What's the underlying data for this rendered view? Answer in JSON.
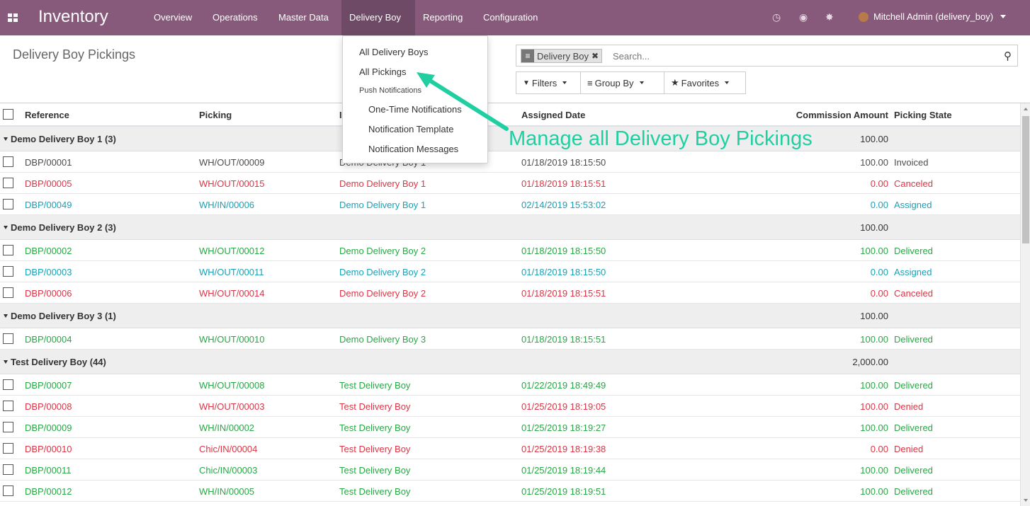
{
  "topbar": {
    "app_title": "Inventory",
    "menu": [
      "Overview",
      "Operations",
      "Master Data",
      "Delivery Boy",
      "Reporting",
      "Configuration"
    ],
    "active_menu": "Delivery Boy",
    "user": "Mitchell Admin (delivery_boy)",
    "icons": [
      "apps-icon",
      "clock-icon",
      "chat-icon",
      "bug-icon",
      "avatar"
    ],
    "colors": {
      "bar": "#875a7b",
      "active": "#6f4a66"
    }
  },
  "control_panel": {
    "breadcrumb": "Delivery Boy Pickings",
    "search": {
      "facet": "Delivery Boy",
      "placeholder": "Search..."
    },
    "buttons": {
      "filters": "Filters",
      "group_by": "Group By",
      "favorites": "Favorites"
    }
  },
  "dropdown": {
    "items": [
      "All Delivery Boys",
      "All Pickings"
    ],
    "header": "Push Notifications",
    "sub_items": [
      "One-Time Notifications",
      "Notification Template",
      "Notification Messages"
    ]
  },
  "annotation": {
    "text": "Manage all Delivery Boy Pickings",
    "color": "#1fcfa1"
  },
  "table": {
    "headers": [
      "Reference",
      "Picking",
      "Delivery Boy",
      "Assigned Date",
      "Commission Amount",
      "Picking State"
    ],
    "header_visible": [
      "Reference",
      "Picking",
      "I",
      "Assigned Date",
      "Commission Amount",
      "Picking State"
    ],
    "groups": [
      {
        "label": "Demo Delivery Boy 1 (3)",
        "total": "100.00",
        "rows": [
          {
            "ref": "DBP/00001",
            "picking": "WH/OUT/00009",
            "boy": "Demo Delivery Boy 1",
            "date": "01/18/2019 18:15:50",
            "amount": "100.00",
            "state": "Invoiced",
            "color": "default"
          },
          {
            "ref": "DBP/00005",
            "picking": "WH/OUT/00015",
            "boy": "Demo Delivery Boy 1",
            "date": "01/18/2019 18:15:51",
            "amount": "0.00",
            "state": "Canceled",
            "color": "red"
          },
          {
            "ref": "DBP/00049",
            "picking": "WH/IN/00006",
            "boy": "Demo Delivery Boy 1",
            "date": "02/14/2019 15:53:02",
            "amount": "0.00",
            "state": "Assigned",
            "color": "blue"
          }
        ]
      },
      {
        "label": "Demo Delivery Boy 2 (3)",
        "total": "100.00",
        "rows": [
          {
            "ref": "DBP/00002",
            "picking": "WH/OUT/00012",
            "boy": "Demo Delivery Boy 2",
            "date": "01/18/2019 18:15:50",
            "amount": "100.00",
            "state": "Delivered",
            "color": "green"
          },
          {
            "ref": "DBP/00003",
            "picking": "WH/OUT/00011",
            "boy": "Demo Delivery Boy 2",
            "date": "01/18/2019 18:15:50",
            "amount": "0.00",
            "state": "Assigned",
            "color": "blue"
          },
          {
            "ref": "DBP/00006",
            "picking": "WH/OUT/00014",
            "boy": "Demo Delivery Boy 2",
            "date": "01/18/2019 18:15:51",
            "amount": "0.00",
            "state": "Canceled",
            "color": "red"
          }
        ]
      },
      {
        "label": "Demo Delivery Boy 3 (1)",
        "total": "100.00",
        "rows": [
          {
            "ref": "DBP/00004",
            "picking": "WH/OUT/00010",
            "boy": "Demo Delivery Boy 3",
            "date": "01/18/2019 18:15:51",
            "amount": "100.00",
            "state": "Delivered",
            "color": "green"
          }
        ]
      },
      {
        "label": "Test Delivery Boy (44)",
        "total": "2,000.00",
        "rows": [
          {
            "ref": "DBP/00007",
            "picking": "WH/OUT/00008",
            "boy": "Test Delivery Boy",
            "date": "01/22/2019 18:49:49",
            "amount": "100.00",
            "state": "Delivered",
            "color": "green"
          },
          {
            "ref": "DBP/00008",
            "picking": "WH/OUT/00003",
            "boy": "Test Delivery Boy",
            "date": "01/25/2019 18:19:05",
            "amount": "100.00",
            "state": "Denied",
            "color": "red"
          },
          {
            "ref": "DBP/00009",
            "picking": "WH/IN/00002",
            "boy": "Test Delivery Boy",
            "date": "01/25/2019 18:19:27",
            "amount": "100.00",
            "state": "Delivered",
            "color": "green"
          },
          {
            "ref": "DBP/00010",
            "picking": "Chic/IN/00004",
            "boy": "Test Delivery Boy",
            "date": "01/25/2019 18:19:38",
            "amount": "0.00",
            "state": "Denied",
            "color": "red"
          },
          {
            "ref": "DBP/00011",
            "picking": "Chic/IN/00003",
            "boy": "Test Delivery Boy",
            "date": "01/25/2019 18:19:44",
            "amount": "100.00",
            "state": "Delivered",
            "color": "green"
          },
          {
            "ref": "DBP/00012",
            "picking": "WH/IN/00005",
            "boy": "Test Delivery Boy",
            "date": "01/25/2019 18:19:51",
            "amount": "100.00",
            "state": "Delivered",
            "color": "green"
          }
        ]
      }
    ]
  }
}
